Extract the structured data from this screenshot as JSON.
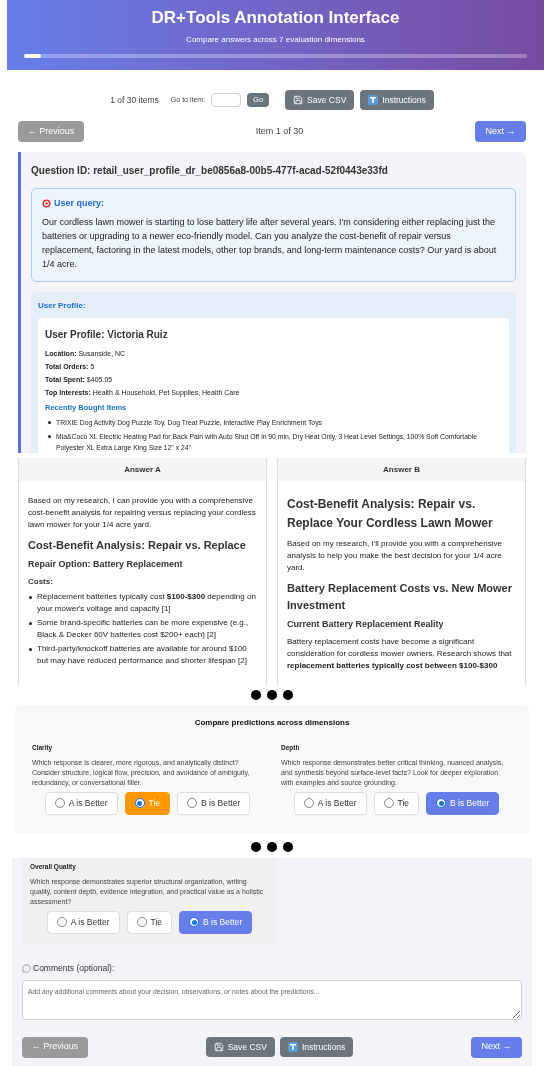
{
  "header": {
    "title": "DR+Tools Annotation Interface",
    "subtitle": "Compare answers across 7 evaluation dimensions",
    "progress": {
      "level": 0.033
    }
  },
  "toolbar": {
    "count": "1 of 30 items",
    "goto_label": "Go to item:",
    "go_button": "Go",
    "buttons": [
      {
        "kind": "save",
        "label": "Save CSV"
      },
      {
        "kind": "instructions",
        "label": "Instructions"
      }
    ]
  },
  "nav": {
    "previous": {
      "label": "← Previous",
      "disabled": true
    },
    "position": "Item 1 of 30",
    "next": {
      "label": "Next →",
      "disabled": false
    }
  },
  "question": {
    "id_line": "Question ID: retail_user_profile_dr_be0856a8-00b5-477f-acad-52f0443e33fd",
    "query_title": "User query:",
    "query": "Our cordless lawn mower is starting to lose battery life after several years. I'm considering either replacing just the batteries or upgrading to a newer eco-friendly model. Can you analyze the cost-benefit of repair versus replacement, factoring in the latest models, other top brands, and long-term maintenance costs? Our yard is about 1/4 acre.",
    "profile_title": "User Profile:",
    "profile": {
      "name": "User Profile: Victoria Ruiz",
      "fields": [
        "**Location:** Susanside, NC",
        "**Total Orders:** 5",
        "**Total Spent:** $405.05",
        "**Top Interests:** Health & Household, Pet Supplies, Health Care"
      ],
      "recent_title": "Recently Bought Items",
      "recent_items": [
        "TRIXIE Dog Activity Dog Puzzle Toy, Dog Treat Puzzle, Interactive Play Enrichment Toys",
        "Mia&Coco XL Electric Heating Pad for Back Pain with Auto Shut Off in 90 min, Dry Heat Only, 3 Heat Level Settings, 100% Soft Comfortable Polyester XL Extra Large King Size 12\" x 24\""
      ]
    }
  },
  "answers": [
    {
      "title": "Answer A",
      "blocks": [
        {
          "kind": "p",
          "text": "Based on my research, I can provide you with a comprehensive cost-benefit analysis for repairing versus replacing your cordless lawn mower for your 1/4 acre yard."
        },
        {
          "kind": "h2",
          "text": "Cost-Benefit Analysis: Repair vs. Replace"
        },
        {
          "kind": "h3",
          "text": "Repair Option: Battery Replacement"
        },
        {
          "kind": "h4",
          "text": "Costs:"
        },
        {
          "kind": "li",
          "text": "Replacement batteries typically cost **$100-$300** depending on your mower's voltage and capacity [1]"
        },
        {
          "kind": "li",
          "text": "Some brand-specific batteries can be more expensive (e.g., Black & Decker 60V batteries cost $200+ each) [2]"
        },
        {
          "kind": "li",
          "text": "Third-party/knockoff batteries are available for around $100 but may have reduced performance and shorter lifespan [2]"
        }
      ]
    },
    {
      "title": "Answer B",
      "blocks": [
        {
          "kind": "h1",
          "text": "Cost-Benefit Analysis: Repair vs. Replace Your Cordless Lawn Mower"
        },
        {
          "kind": "p",
          "text": "Based on my research, I'll provide you with a comprehensive analysis to help you make the best decision for your 1/4 acre yard."
        },
        {
          "kind": "h2",
          "text": "Battery Replacement Costs vs. New Mower Investment"
        },
        {
          "kind": "h3",
          "text": "Current Battery Replacement Reality"
        },
        {
          "kind": "p",
          "text": "Battery replacement costs have become a significant consideration for cordless mower owners. Research shows that **replacement batteries typically cost between $100-$300**"
        }
      ]
    }
  ],
  "dimensions": {
    "title": "Compare predictions across dimensions",
    "items": [
      {
        "name": "Clarity",
        "description": "Which response is clearer, more rigorous, and analytically distinct? Consider structure, logical flow, precision, and avoidance of ambiguity, redundancy, or conversational filler.",
        "color": "#ff9800",
        "options": [
          {
            "label": "A is Better",
            "selected": false
          },
          {
            "label": "Tie",
            "selected": true
          },
          {
            "label": "B is Better",
            "selected": false
          }
        ]
      },
      {
        "name": "Depth",
        "description": "Which response demonstrates better critical thinking, nuanced analysis, and synthesis beyond surface-level facts? Look for deeper exploration with examples and source grounding.",
        "color": "#667eea",
        "options": [
          {
            "label": "A is Better",
            "selected": false
          },
          {
            "label": "Tie",
            "selected": false
          },
          {
            "label": "B is Better",
            "selected": true
          }
        ]
      }
    ]
  },
  "overall": {
    "name": "Overall Quality",
    "description": "Which response demonstrates superior structural organization, writing quality, content depth, evidence integration, and practical value as a holistic assessment?",
    "color": "#667eea",
    "options": [
      {
        "label": "A is Better",
        "selected": false
      },
      {
        "label": "Tie",
        "selected": false
      },
      {
        "label": "B is Better",
        "selected": true
      }
    ]
  },
  "comments": {
    "label": "Comments (optional):",
    "placeholder": "Add any additional comments about your decision, observations, or notes about the predictions..."
  },
  "footer": {
    "previous": {
      "label": "← Previous",
      "disabled": true
    },
    "buttons": [
      {
        "kind": "save",
        "label": "Save CSV"
      },
      {
        "kind": "instructions",
        "label": "Instructions"
      }
    ],
    "next": {
      "label": "Next →",
      "disabled": false
    }
  }
}
